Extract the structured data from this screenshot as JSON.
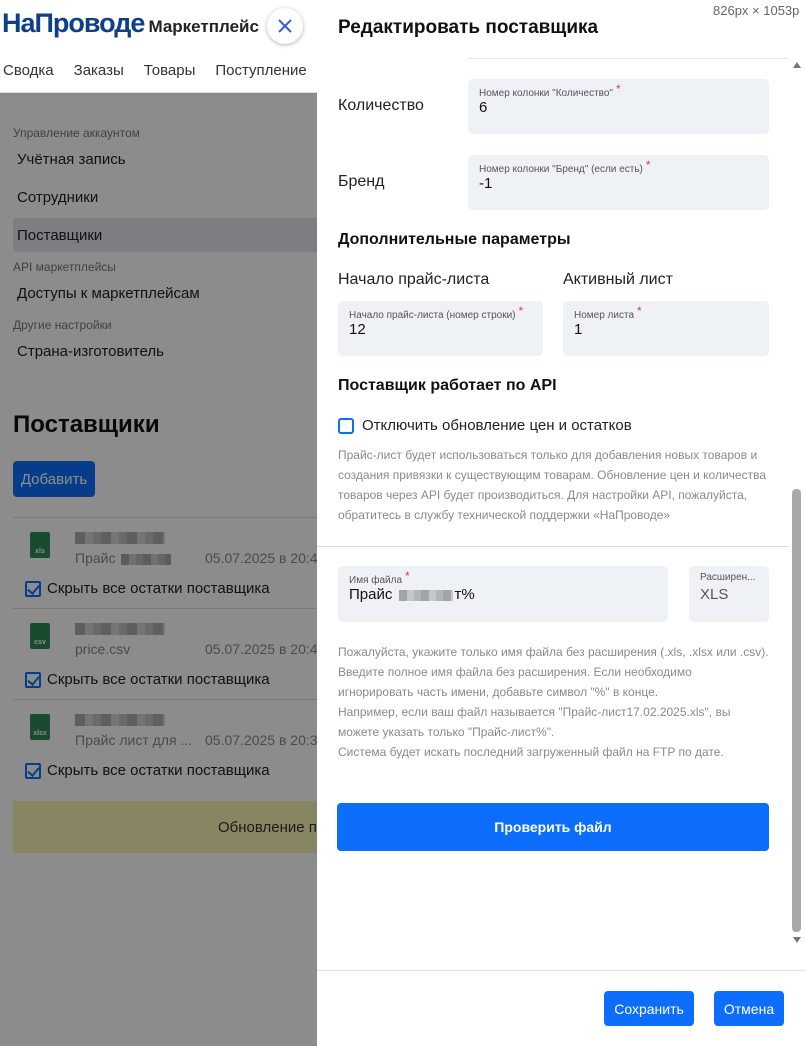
{
  "logo": {
    "main": "НаПроводе",
    "sub": "Маркетплейс"
  },
  "topnav": [
    "Сводка",
    "Заказы",
    "Товары",
    "Поступление"
  ],
  "sidebar": {
    "account_section": "Управление аккаунтом",
    "items": [
      "Учётная запись",
      "Сотрудники",
      "Поставщики"
    ],
    "api_section": "API маркетплейсы",
    "api_items": [
      "Доступы к маркетплейсам"
    ],
    "other_section": "Другие настройки",
    "other_items": [
      "Страна-изготовитель"
    ]
  },
  "page": {
    "title": "Поставщики",
    "add_label": "Добавить"
  },
  "suppliers": [
    {
      "icon_label": "xls",
      "file_name": "Прайс",
      "date": "05.07.2025 в 20:4",
      "hide_label": "Скрыть все остатки поставщика"
    },
    {
      "icon_label": "csv",
      "file_name": "price.csv",
      "date": "05.07.2025 в 20:4",
      "hide_label": "Скрыть все остатки поставщика"
    },
    {
      "icon_label": "xlsx",
      "file_name": "Прайс лист для ...",
      "date": "05.07.2025 в 20:3",
      "hide_label": "Скрыть все остатки поставщика"
    }
  ],
  "banner": "Обновление пр",
  "dimensions_label": "826px × 1053p",
  "modal": {
    "title": "Редактировать поставщика",
    "quantity": {
      "label": "Количество",
      "field_label": "Номер колонки \"Количество\"",
      "value": "6"
    },
    "brand": {
      "label": "Бренд",
      "field_label": "Номер колонки \"Бренд\" (если есть)",
      "value": "-1"
    },
    "extra_heading": "Дополнительные параметры",
    "price_start": {
      "label": "Начало прайс-листа",
      "field_label": "Начало прайс-листа (номер строки)",
      "value": "12"
    },
    "active_sheet": {
      "label": "Активный лист",
      "field_label": "Номер листа",
      "value": "1"
    },
    "api_heading": "Поставщик работает по API",
    "api_checkbox": "Отключить обновление цен и остатков",
    "api_help": "Прайс-лист будет использоваться только для добавления новых товаров и создания привязки к существующим товарам. Обновление цен и количества товаров через API будет производиться. Для настройки API, пожалуйста, обратитесь в службу технической поддержки «НаПроводе»",
    "file_name": {
      "field_label": "Имя файла",
      "value_prefix": "Прайс",
      "value_suffix": "т%"
    },
    "extension": {
      "field_label": "Расширен...",
      "value": "XLS"
    },
    "file_help": [
      "Пожалуйста, укажите только имя файла без расширения (.xls, .xlsx или .csv).",
      "Введите полное имя файла без расширения. Если необходимо",
      "игнорировать часть имени, добавьте символ \"%\" в конце.",
      "Например, если ваш файл называется \"Прайс-лист17.02.2025.xls\", вы",
      "можете указать только \"Прайс-лист%\".",
      "Система будет искать последний загруженный файл на FTP по дате."
    ],
    "check_button": "Проверить файл",
    "save_button": "Сохранить",
    "cancel_button": "Отмена",
    "required_mark": "*"
  },
  "colors": {
    "primary": "#0d6efd",
    "field_bg": "#eef1f6",
    "required": "#e53935",
    "logo": "#0d3f8a"
  }
}
